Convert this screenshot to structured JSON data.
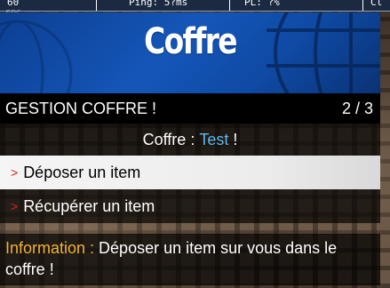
{
  "hud": {
    "fps_value": "60",
    "ping": "Ping: 5?ms",
    "pl": "PL: ?%",
    "extra": "Cl",
    "fps_label": "FPS"
  },
  "menu": {
    "banner_title": "Coffre",
    "subtitle": "GESTION COFFRE !",
    "counter": "2 / 3",
    "chest_label": "Coffre : ",
    "chest_name": "Test",
    "chest_suffix": " !",
    "items": [
      {
        "arrow": ">",
        "label": "Déposer un item",
        "selected": true
      },
      {
        "arrow": ">",
        "label": "Récupérer un item",
        "selected": false
      }
    ],
    "info_label": "Information :",
    "info_text": " Déposer un item sur vous dans le coffre !"
  },
  "colors": {
    "banner_blue": "#1456b8",
    "selector_arrow": "#e0201c",
    "chest_name": "#5fb8e8",
    "info_label": "#f2b233"
  }
}
